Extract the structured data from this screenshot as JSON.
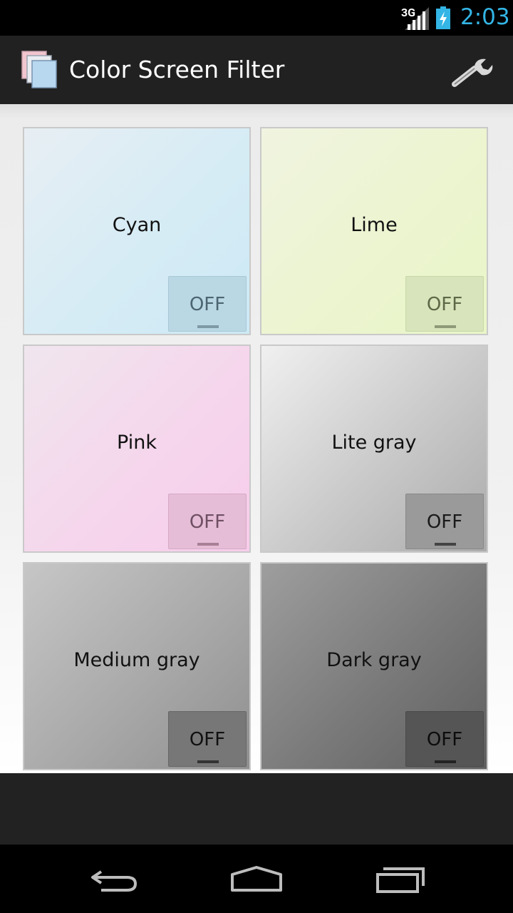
{
  "status_bar": {
    "network": "3G",
    "time": "2:03",
    "icons": [
      "signal-icon",
      "battery-charging-icon"
    ]
  },
  "action_bar": {
    "title": "Color Screen Filter",
    "app_icon": "app-icon",
    "settings_icon": "wrench-icon"
  },
  "filters": [
    {
      "name": "Cyan",
      "toggle": "OFF"
    },
    {
      "name": "Lime",
      "toggle": "OFF"
    },
    {
      "name": "Pink",
      "toggle": "OFF"
    },
    {
      "name": "Lite gray",
      "toggle": "OFF"
    },
    {
      "name": "Medium gray",
      "toggle": "OFF"
    },
    {
      "name": "Dark gray",
      "toggle": "OFF"
    }
  ],
  "navigation": {
    "icons": [
      "back-icon",
      "home-icon",
      "recent-apps-icon"
    ]
  },
  "colors": {
    "time": "#33b5e5",
    "action_bar": "#212121",
    "cyan": "#d6ecf5",
    "lime": "#ecf4d0",
    "pink": "#f5d6ec",
    "lite_gray": "#c9c9c9",
    "medium_gray": "#a9a9a9",
    "dark_gray": "#7a7a7a"
  }
}
